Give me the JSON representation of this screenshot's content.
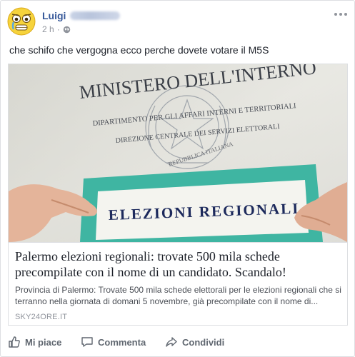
{
  "post": {
    "author": "Luigi",
    "time": "2 h",
    "separator": "·",
    "privacy_icon": "globe-icon",
    "text": "che schifo che vergogna ecco perche dovete votare il M5S"
  },
  "link_card": {
    "image": {
      "ministry": "MINISTERO DELL'INTERNO",
      "department": "DIPARTIMENTO PER GLI AFFARI INTERNI E TERRITORIALI",
      "direction": "DIREZIONE CENTRALE DEI SERVIZI ELETTORALI",
      "seal_text": "REPUBBLICA ITALIANA",
      "ballot_label": "ELEZIONI REGIONALI"
    },
    "title": "Palermo elezioni regionali: trovate 500 mila schede precompilate con il nome di un candidato. Scandalo!",
    "description": "Provincia di Palermo: Trovate 500 mila schede elettorali per le elezioni regionali che si terranno nella giornata di domani 5 novembre, già precompilate con il nome di...",
    "domain": "SKY24ORE.IT"
  },
  "actions": {
    "like": "Mi piace",
    "comment": "Commenta",
    "share": "Condividi"
  },
  "colors": {
    "author_link": "#365899",
    "meta": "#90949c",
    "action": "#606770"
  }
}
